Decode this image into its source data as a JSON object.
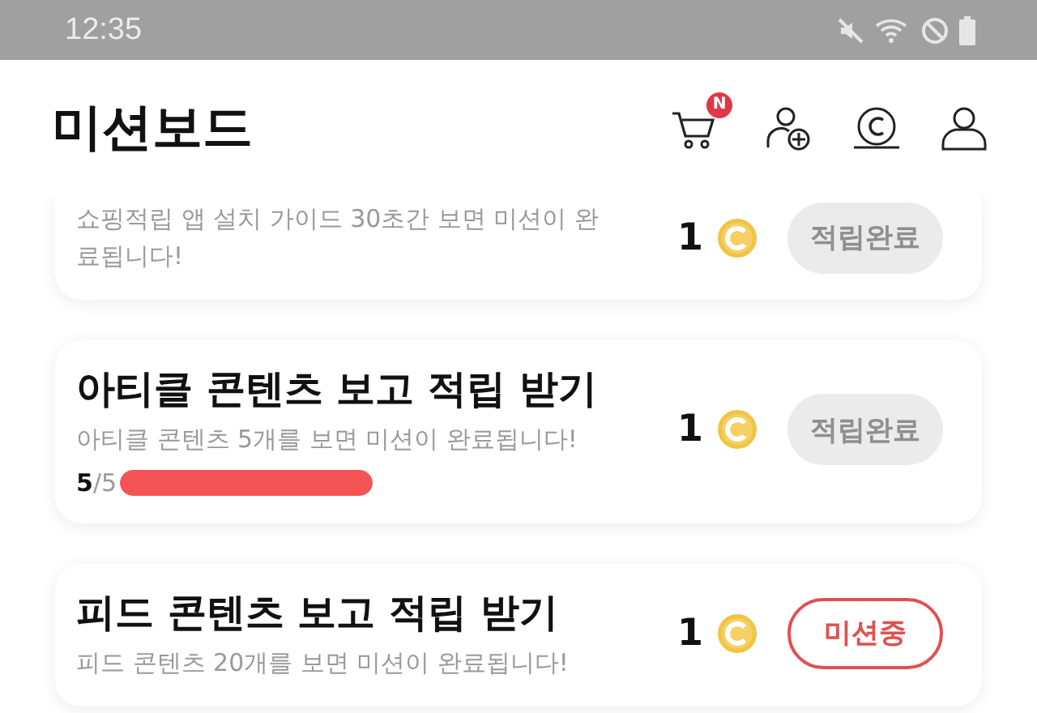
{
  "status_bar": {
    "time": "12:35"
  },
  "header": {
    "title": "미션보드",
    "cart_badge": "N"
  },
  "missions": [
    {
      "description": "쇼핑적립 앱 설치 가이드 30초간 보면 미션이 완료됩니다!",
      "reward": "1",
      "button": "적립완료",
      "done": true
    },
    {
      "title": "아티클 콘텐츠 보고 적립 받기",
      "description": "아티클 콘텐츠 5개를 보면 미션이 완료됩니다!",
      "progress": {
        "text": "**5**/5",
        "level": 1
      },
      "reward": "1",
      "button": "적립완료",
      "done": true
    },
    {
      "title": "피드 콘텐츠 보고 적립 받기",
      "description": "피드 콘텐츠 20개를 보면 미션이 완료됩니다!",
      "reward": "1",
      "button": "미션중",
      "done": false
    }
  ]
}
